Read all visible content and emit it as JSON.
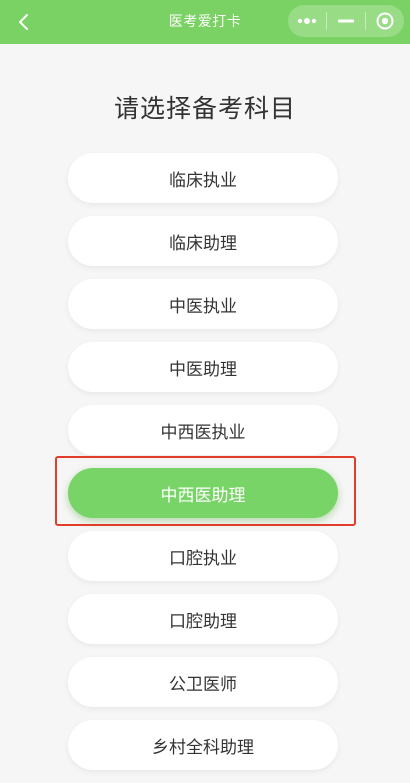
{
  "header": {
    "title": "医考爱打卡",
    "back_icon": "chevron-left-icon",
    "capsule": {
      "more_icon": "more-dots-icon",
      "minimize_icon": "minimize-icon",
      "close_icon": "target-circle-icon"
    }
  },
  "page": {
    "heading": "请选择备考科目"
  },
  "subjects": [
    {
      "label": "临床执业"
    },
    {
      "label": "临床助理"
    },
    {
      "label": "中医执业"
    },
    {
      "label": "中医助理"
    },
    {
      "label": "中西医执业"
    },
    {
      "label": "中西医助理",
      "selected": true
    },
    {
      "label": "口腔执业"
    },
    {
      "label": "口腔助理"
    },
    {
      "label": "公卫医师"
    },
    {
      "label": "乡村全科助理"
    }
  ],
  "colors": {
    "brand_green": "#7bd264",
    "selected_green": "#78d466",
    "highlight_red": "#e23c2b",
    "background": "#f6f6f6"
  }
}
